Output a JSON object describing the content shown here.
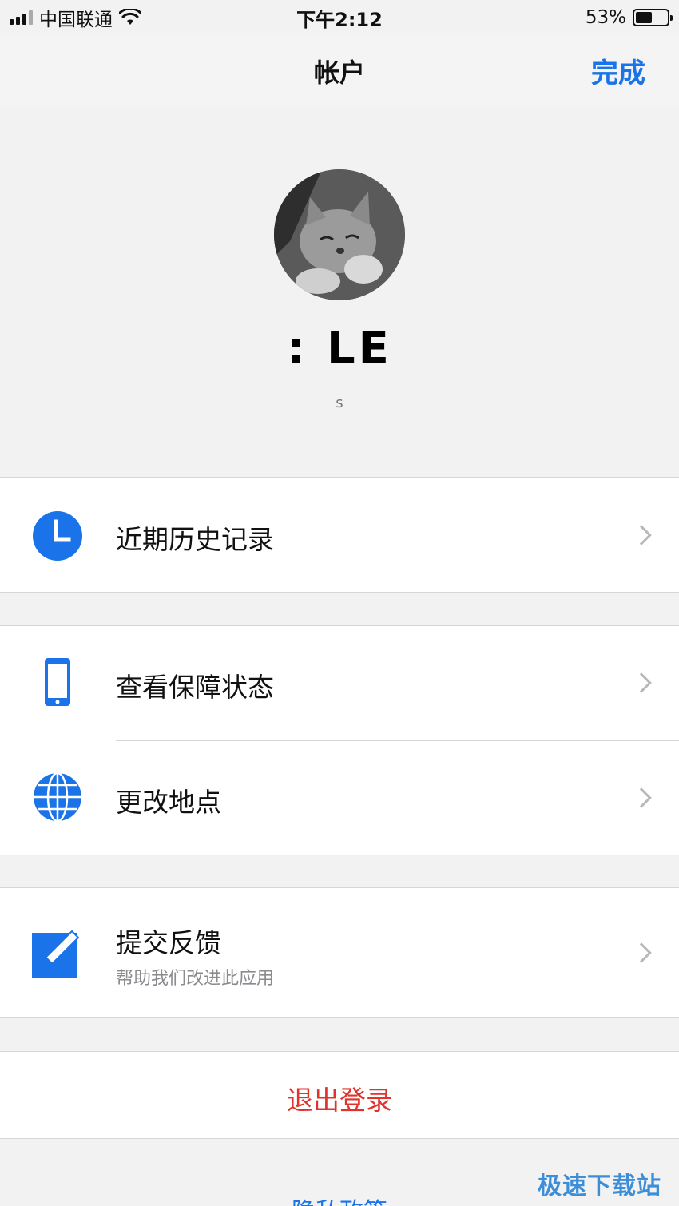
{
  "status_bar": {
    "carrier": "中国联通",
    "time": "下午2:12",
    "battery": "53%",
    "battery_level": 0.53
  },
  "nav": {
    "title": "帐户",
    "done": "完成"
  },
  "profile": {
    "username": ": LE",
    "subtitle": "s"
  },
  "menu": {
    "history": {
      "label": "近期历史记录",
      "icon": "clock-icon",
      "color": "#1a73e8"
    },
    "protection": {
      "label": "查看保障状态",
      "icon": "phone-icon",
      "color": "#1a73e8"
    },
    "location": {
      "label": "更改地点",
      "icon": "globe-icon",
      "color": "#1a73e8"
    },
    "feedback": {
      "label": "提交反馈",
      "sub": "帮助我们改进此应用",
      "icon": "edit-icon",
      "color": "#1a73e8"
    }
  },
  "logout": {
    "label": "退出登录",
    "color": "#e0332c"
  },
  "footer": {
    "privacy": "隐私政策",
    "watermark": "极速下载站"
  }
}
